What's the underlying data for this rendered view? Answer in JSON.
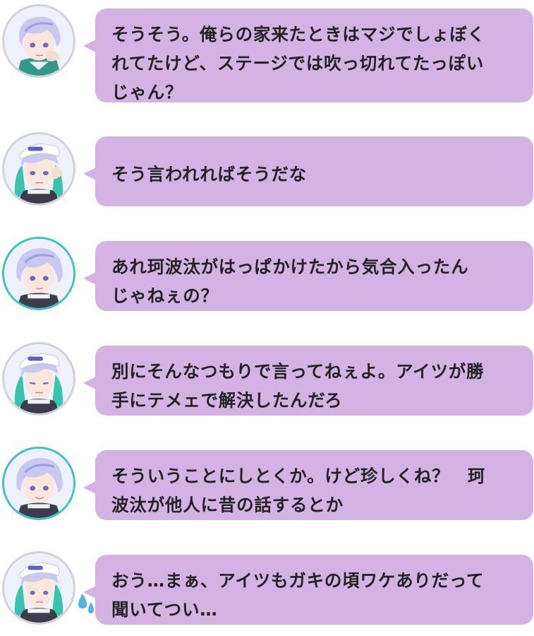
{
  "messages": [
    {
      "speaker_icon": "white-hair-green-jacket-avatar",
      "text": "そうそう。俺らの家来たときはマジでしょぼく\nれてたけど、ステージでは吹っ切れてたっぽい\nじゃん？"
    },
    {
      "speaker_icon": "white-cap-teal-hair-avatar",
      "text": "そう言われればそうだな"
    },
    {
      "speaker_icon": "white-hair-teal-ring-avatar",
      "text": "あれ珂波汰がはっぱかけたから気合入ったん\nじゃねぇの？"
    },
    {
      "speaker_icon": "white-cap-teal-hair-avatar",
      "text": "別にそんなつもりで言ってねぇよ。アイツが勝\n手にテメェで解決したんだろ"
    },
    {
      "speaker_icon": "white-hair-teal-ring-avatar",
      "text": "そういうことにしとくか。けど珍しくね？　珂\n波汰が他人に昔の話するとか"
    },
    {
      "speaker_icon": "white-cap-teal-hair-avatar",
      "text": "おう…まぁ、アイツもガキの頃ワケありだって\n聞いてつい…"
    }
  ],
  "colors": {
    "bubble": "#d5b2e4",
    "text": "#222222",
    "ring_teal": "#3ec3bf",
    "ring_gray": "#d2d2d2",
    "sweat_drop": "#4fb3e8"
  }
}
